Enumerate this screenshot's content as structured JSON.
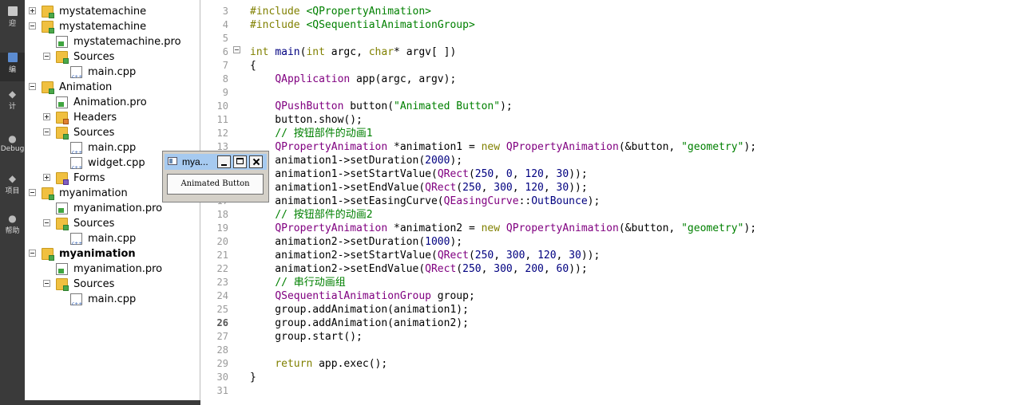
{
  "sidebar_modes": [
    {
      "label": "迎",
      "active": false
    },
    {
      "label": "编",
      "active": true
    },
    {
      "label": "计",
      "active": false
    },
    {
      "label": "Debug",
      "active": false
    },
    {
      "label": "项目",
      "active": false
    },
    {
      "label": "帮助",
      "active": false
    }
  ],
  "project_tree": [
    {
      "label": "mystatemachine",
      "icon": "project-folder-icon"
    },
    {
      "label": "mystatemachine",
      "icon": "project-folder-icon"
    },
    {
      "label": "mystatemachine.pro",
      "icon": "pro-file-icon"
    },
    {
      "label": "Sources",
      "icon": "sources-folder-icon"
    },
    {
      "label": "main.cpp",
      "icon": "cpp-file-icon"
    },
    {
      "label": "Animation",
      "icon": "project-folder-icon"
    },
    {
      "label": "Animation.pro",
      "icon": "pro-file-icon"
    },
    {
      "label": "Headers",
      "icon": "headers-folder-icon"
    },
    {
      "label": "Sources",
      "icon": "sources-folder-icon"
    },
    {
      "label": "main.cpp",
      "icon": "cpp-file-icon"
    },
    {
      "label": "widget.cpp",
      "icon": "cpp-file-icon"
    },
    {
      "label": "Forms",
      "icon": "forms-folder-icon"
    },
    {
      "label": "myanimation",
      "icon": "project-folder-icon"
    },
    {
      "label": "myanimation.pro",
      "icon": "pro-file-icon"
    },
    {
      "label": "Sources",
      "icon": "sources-folder-icon"
    },
    {
      "label": "main.cpp",
      "icon": "cpp-file-icon"
    },
    {
      "label": "myanimation",
      "icon": "project-folder-icon",
      "active": true
    },
    {
      "label": "myanimation.pro",
      "icon": "pro-file-icon"
    },
    {
      "label": "Sources",
      "icon": "sources-folder-icon"
    },
    {
      "label": "main.cpp",
      "icon": "cpp-file-icon"
    }
  ],
  "editor": {
    "current_line": "26",
    "lines": [
      {
        "n": "3",
        "tokens": [
          [
            "#include ",
            "kw"
          ],
          [
            "<QPropertyAnimation>",
            "st"
          ]
        ]
      },
      {
        "n": "4",
        "tokens": [
          [
            "#include ",
            "kw"
          ],
          [
            "<QSequentialAnimationGroup>",
            "st"
          ]
        ]
      },
      {
        "n": "5",
        "tokens": []
      },
      {
        "n": "6",
        "tokens": [
          [
            "int",
            "kw"
          ],
          [
            " ",
            ""
          ],
          [
            "main",
            "nm"
          ],
          [
            "(",
            ""
          ],
          [
            "int",
            "kw"
          ],
          [
            " argc, ",
            ""
          ],
          [
            "char",
            "kw"
          ],
          [
            "* argv[ ])",
            ""
          ]
        ]
      },
      {
        "n": "7",
        "tokens": [
          [
            "{",
            ""
          ]
        ]
      },
      {
        "n": "8",
        "tokens": [
          [
            "    ",
            ""
          ],
          [
            "QApplication",
            "ty"
          ],
          [
            " app(argc, argv);",
            ""
          ]
        ]
      },
      {
        "n": "9",
        "tokens": []
      },
      {
        "n": "10",
        "tokens": [
          [
            "    ",
            ""
          ],
          [
            "QPushButton",
            "ty"
          ],
          [
            " button(",
            ""
          ],
          [
            "\"Animated Button\"",
            "st"
          ],
          [
            ");",
            ""
          ]
        ]
      },
      {
        "n": "11",
        "tokens": [
          [
            "    button.show();",
            ""
          ]
        ]
      },
      {
        "n": "12",
        "tokens": [
          [
            "    ",
            ""
          ],
          [
            "// 按钮部件的动画1",
            "cm"
          ]
        ]
      },
      {
        "n": "13",
        "tokens": [
          [
            "    ",
            ""
          ],
          [
            "QPropertyAnimation",
            "ty"
          ],
          [
            " *animation1 = ",
            ""
          ],
          [
            "new",
            "kw"
          ],
          [
            " ",
            ""
          ],
          [
            "QPropertyAnimation",
            "ty"
          ],
          [
            "(&button, ",
            ""
          ],
          [
            "\"geometry\"",
            "st"
          ],
          [
            ");",
            ""
          ]
        ]
      },
      {
        "n": "14",
        "tokens": [
          [
            "    animation1->setDuration(",
            ""
          ],
          [
            "2000",
            "nm"
          ],
          [
            ");",
            ""
          ]
        ]
      },
      {
        "n": "15",
        "tokens": [
          [
            "    animation1->setStartValue(",
            ""
          ],
          [
            "QRect",
            "ty"
          ],
          [
            "(",
            ""
          ],
          [
            "250",
            "nm"
          ],
          [
            ", ",
            ""
          ],
          [
            "0",
            "nm"
          ],
          [
            ", ",
            ""
          ],
          [
            "120",
            "nm"
          ],
          [
            ", ",
            ""
          ],
          [
            "30",
            "nm"
          ],
          [
            "));",
            ""
          ]
        ]
      },
      {
        "n": "16",
        "tokens": [
          [
            "    animation1->setEndValue(",
            ""
          ],
          [
            "QRect",
            "ty"
          ],
          [
            "(",
            ""
          ],
          [
            "250",
            "nm"
          ],
          [
            ", ",
            ""
          ],
          [
            "300",
            "nm"
          ],
          [
            ", ",
            ""
          ],
          [
            "120",
            "nm"
          ],
          [
            ", ",
            ""
          ],
          [
            "30",
            "nm"
          ],
          [
            "));",
            ""
          ]
        ]
      },
      {
        "n": "17",
        "tokens": [
          [
            "    animation1->setEasingCurve(",
            ""
          ],
          [
            "QEasingCurve",
            "ty"
          ],
          [
            "::",
            ""
          ],
          [
            "OutBounce",
            "nm"
          ],
          [
            ");",
            ""
          ]
        ]
      },
      {
        "n": "18",
        "tokens": [
          [
            "    ",
            ""
          ],
          [
            "// 按钮部件的动画2",
            "cm"
          ]
        ]
      },
      {
        "n": "19",
        "tokens": [
          [
            "    ",
            ""
          ],
          [
            "QPropertyAnimation",
            "ty"
          ],
          [
            " *animation2 = ",
            ""
          ],
          [
            "new",
            "kw"
          ],
          [
            " ",
            ""
          ],
          [
            "QPropertyAnimation",
            "ty"
          ],
          [
            "(&button, ",
            ""
          ],
          [
            "\"geometry\"",
            "st"
          ],
          [
            ");",
            ""
          ]
        ]
      },
      {
        "n": "20",
        "tokens": [
          [
            "    animation2->setDuration(",
            ""
          ],
          [
            "1000",
            "nm"
          ],
          [
            ");",
            ""
          ]
        ]
      },
      {
        "n": "21",
        "tokens": [
          [
            "    animation2->setStartValue(",
            ""
          ],
          [
            "QRect",
            "ty"
          ],
          [
            "(",
            ""
          ],
          [
            "250",
            "nm"
          ],
          [
            ", ",
            ""
          ],
          [
            "300",
            "nm"
          ],
          [
            ", ",
            ""
          ],
          [
            "120",
            "nm"
          ],
          [
            ", ",
            ""
          ],
          [
            "30",
            "nm"
          ],
          [
            "));",
            ""
          ]
        ]
      },
      {
        "n": "22",
        "tokens": [
          [
            "    animation2->setEndValue(",
            ""
          ],
          [
            "QRect",
            "ty"
          ],
          [
            "(",
            ""
          ],
          [
            "250",
            "nm"
          ],
          [
            ", ",
            ""
          ],
          [
            "300",
            "nm"
          ],
          [
            ", ",
            ""
          ],
          [
            "200",
            "nm"
          ],
          [
            ", ",
            ""
          ],
          [
            "60",
            "nm"
          ],
          [
            "));",
            ""
          ]
        ]
      },
      {
        "n": "23",
        "tokens": [
          [
            "    ",
            ""
          ],
          [
            "// 串行动画组",
            "cm"
          ]
        ]
      },
      {
        "n": "24",
        "tokens": [
          [
            "    ",
            ""
          ],
          [
            "QSequentialAnimationGroup",
            "ty"
          ],
          [
            " group;",
            ""
          ]
        ]
      },
      {
        "n": "25",
        "tokens": [
          [
            "    group.addAnimation(animation1);",
            ""
          ]
        ]
      },
      {
        "n": "26",
        "tokens": [
          [
            "    group.addAnimation(animation2);",
            ""
          ]
        ]
      },
      {
        "n": "27",
        "tokens": [
          [
            "    group.start();",
            ""
          ]
        ]
      },
      {
        "n": "28",
        "tokens": []
      },
      {
        "n": "29",
        "tokens": [
          [
            "    ",
            ""
          ],
          [
            "return",
            "kw"
          ],
          [
            " app.exec();",
            ""
          ]
        ]
      },
      {
        "n": "30",
        "tokens": [
          [
            "}",
            ""
          ]
        ]
      },
      {
        "n": "31",
        "tokens": []
      }
    ]
  },
  "floating_window": {
    "title": "mya...",
    "button_label": "Animated Button"
  },
  "colors": {
    "keyword": "#808000",
    "type": "#800080",
    "string": "#008000",
    "number": "#000080",
    "comment": "#008000"
  }
}
